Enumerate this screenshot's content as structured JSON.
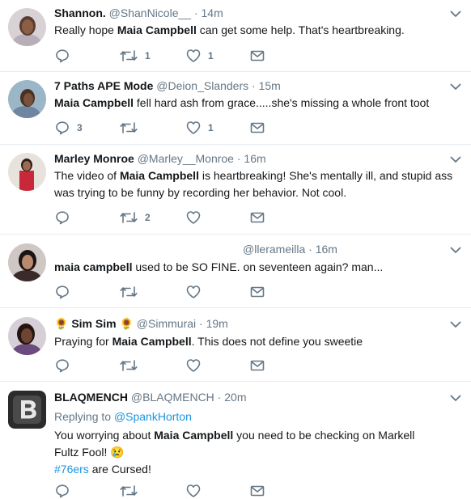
{
  "theme": {
    "text": "#14171a",
    "muted": "#657786",
    "link": "#1b95e0",
    "border": "#e6ecf0"
  },
  "tweets": [
    {
      "display_name": "Shannon.",
      "handle": "@ShanNicole__",
      "time": "14m",
      "text_pre": "Really hope ",
      "text_bold": "Maia Campbell",
      "text_post": " can get some help. That's heartbreaking.",
      "reply_count": "",
      "retweet_count": "1",
      "like_count": "1"
    },
    {
      "display_name": "7 Paths APE Mode",
      "handle": "@Deion_Slanders",
      "time": "15m",
      "text_bold": "Maia Campbell",
      "text_post": " fell hard ash from grace.....she's missing a whole front toot",
      "reply_count": "3",
      "retweet_count": "",
      "like_count": "1"
    },
    {
      "display_name": "Marley Monroe",
      "handle": "@Marley__Monroe",
      "time": "16m",
      "text_pre": "The video of ",
      "text_bold": "Maia Campbell",
      "text_post": " is heartbreaking! She's mentally ill, and stupid ass was trying to be funny by recording her behavior. Not cool.",
      "reply_count": "",
      "retweet_count": "2",
      "like_count": ""
    },
    {
      "display_name": "",
      "handle": "@llerameilla",
      "time": "16m",
      "text_bold": "maia campbell",
      "text_post": " used to be SO FINE. on seventeen again? man...",
      "reply_count": "",
      "retweet_count": "",
      "like_count": ""
    },
    {
      "display_name": "Sim Sim",
      "flower": "🌻",
      "handle": "@Simmurai",
      "time": "19m",
      "text_pre": "Praying for ",
      "text_bold": "Maia Campbell",
      "text_post": ". This does not define you sweetie",
      "reply_count": "",
      "retweet_count": "",
      "like_count": ""
    },
    {
      "display_name": "BLAQMENCH",
      "handle": "@BLAQMENCH",
      "time": "20m",
      "replying_label": "Replying to",
      "replying_handle": "@SpankHorton",
      "text_pre": "You worrying about ",
      "text_bold": "Maia Campbell",
      "text_post": " you need to be checking on Markell Fultz Fool! 😢",
      "hashtag": "#76ers",
      "hashtag_post": " are Cursed!"
    }
  ],
  "separator": " · ",
  "icons": [
    "reply-icon",
    "retweet-icon",
    "like-icon",
    "message-icon",
    "chevron-down-icon"
  ]
}
